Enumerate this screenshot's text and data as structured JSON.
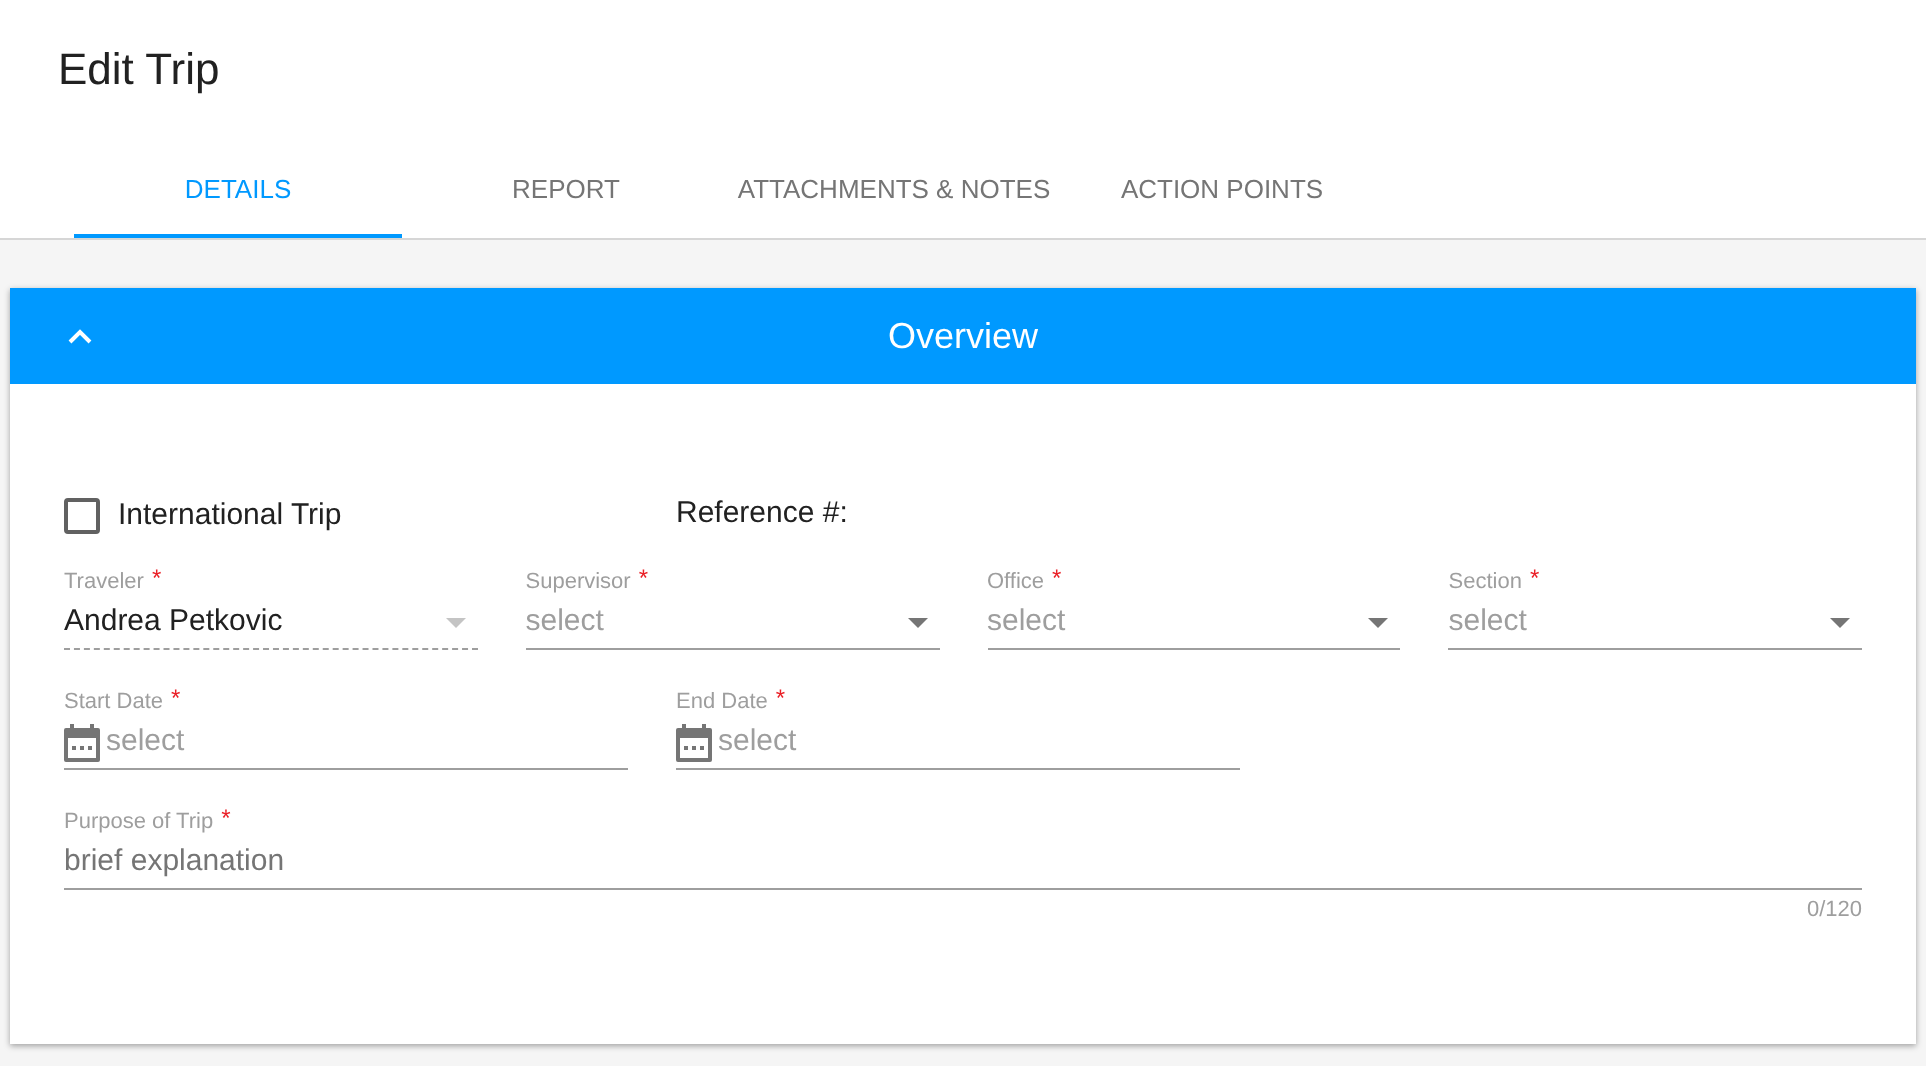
{
  "page_title": "Edit Trip",
  "tabs": [
    {
      "label": "DETAILS",
      "selected": true
    },
    {
      "label": "REPORT",
      "selected": false
    },
    {
      "label": "ATTACHMENTS & NOTES",
      "selected": false
    },
    {
      "label": "ACTION POINTS",
      "selected": false
    }
  ],
  "panel": {
    "title": "Overview",
    "expanded": true
  },
  "international_trip": {
    "label": "International Trip",
    "checked": false
  },
  "reference": {
    "label": "Reference #:"
  },
  "select_fields": [
    {
      "label": "Traveler",
      "required_mark": "*",
      "value": "Andrea Petkovic",
      "disabled": true
    },
    {
      "label": "Supervisor",
      "required_mark": "*",
      "placeholder": "select",
      "disabled": false
    },
    {
      "label": "Office",
      "required_mark": "*",
      "placeholder": "select",
      "disabled": false
    },
    {
      "label": "Section",
      "required_mark": "*",
      "placeholder": "select",
      "disabled": false
    }
  ],
  "date_fields": [
    {
      "label": "Start Date",
      "required_mark": "*",
      "placeholder": "select"
    },
    {
      "label": "End Date",
      "required_mark": "*",
      "placeholder": "select"
    }
  ],
  "purpose": {
    "label": "Purpose of Trip",
    "required_mark": "*",
    "placeholder": "brief explanation",
    "counter": "0/120"
  }
}
